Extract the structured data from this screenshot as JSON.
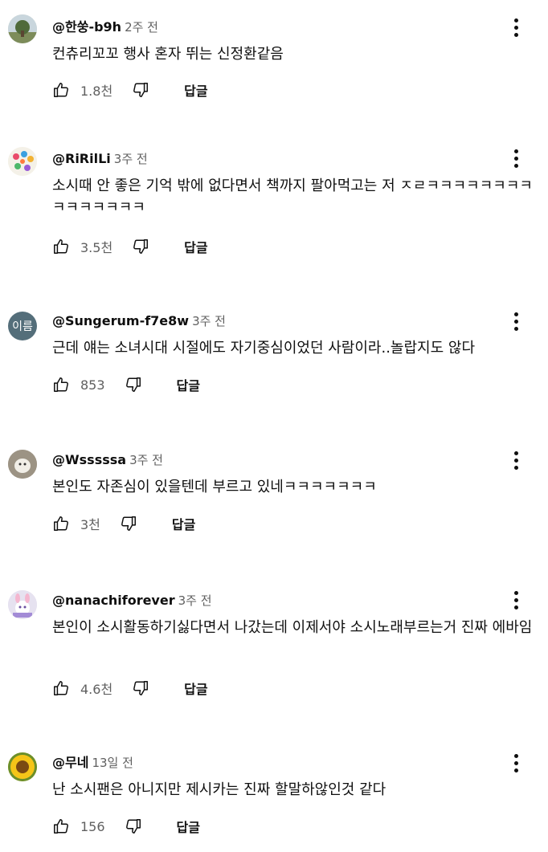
{
  "comments": [
    {
      "author": "@한쑹-b9h",
      "time": "2주 전",
      "text": "컨츄리꼬꼬 행사 혼자 뛰는 신정환같음",
      "likes": "1.8천",
      "reply": "답글",
      "avatar": "landscape-avatar"
    },
    {
      "author": "@RiRilLi",
      "time": "3주 전",
      "text": "소시때 안 좋은 기억 밖에 없다면서 책까지 팔아먹고는 저 ㅈㄹㅋㅋㅋㅋㅋㅋㅋㅋㅋㅋㅋㅋㅋㅋㅋ",
      "likes": "3.5천",
      "reply": "답글",
      "avatar": "colorful-avatar"
    },
    {
      "author": "@Sungerum-f7e8w",
      "time": "3주 전",
      "text": "근데 얘는 소녀시대 시절에도 자기중심이었던 사람이라..놀랍지도 않다",
      "likes": "853",
      "reply": "답글",
      "avatar": "이름"
    },
    {
      "author": "@Wsssssa",
      "time": "3주 전",
      "text": "본인도 자존심이 있을텐데 부르고 있네ㅋㅋㅋㅋㅋㅋㅋ",
      "likes": "3천",
      "reply": "답글",
      "avatar": "photo-avatar"
    },
    {
      "author": "@nanachiforever",
      "time": "3주 전",
      "text": "본인이 소시활동하기싫다면서 나갔는데 이제서야 소시노래부르는거 진짜 에바임",
      "likes": "4.6천",
      "reply": "답글",
      "avatar": "character-avatar"
    },
    {
      "author": "@무네",
      "time": "13일 전",
      "text": "난 소시팬은 아니지만 제시카는 진짜 할말하않인것 같다",
      "likes": "156",
      "reply": "답글",
      "avatar": "sunflower-avatar"
    }
  ]
}
